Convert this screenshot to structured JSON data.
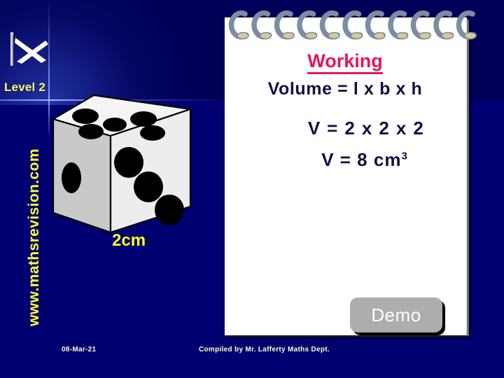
{
  "slide": {
    "background_color_top": "#000058",
    "background_color_bottom": "#000070"
  },
  "branding": {
    "flag_icon": "scotland-saltire-flag-icon",
    "level_label": "Level 2",
    "website": "www.mathsrevision.com",
    "website_color": "#ffff33"
  },
  "figure": {
    "icon": "dice-cube-icon",
    "dimension_label": "2cm",
    "dimension_label_color": "#ffff33",
    "top_face_pips": 5,
    "front_face_pips": 3,
    "left_face_pips": 1
  },
  "notepad": {
    "spiral_ring_count": 11,
    "spiral_ring_color": "#7b8da4",
    "cover_color": "#1a8a1a",
    "page_color": "#ffffff",
    "title": "Working",
    "title_color": "#e4175c",
    "lines": [
      {
        "text": "Volume = l x b x h"
      },
      {
        "text": "V = 2 x 2 x 2"
      },
      {
        "text": "V = 8 cm",
        "superscript": "3"
      }
    ],
    "text_color": "#11113f"
  },
  "controls": {
    "demo_button_label": "Demo",
    "demo_button_color": "#adadad"
  },
  "footer": {
    "date": "08-Mar-21",
    "credit": "Compiled by Mr. Lafferty Maths Dept."
  }
}
